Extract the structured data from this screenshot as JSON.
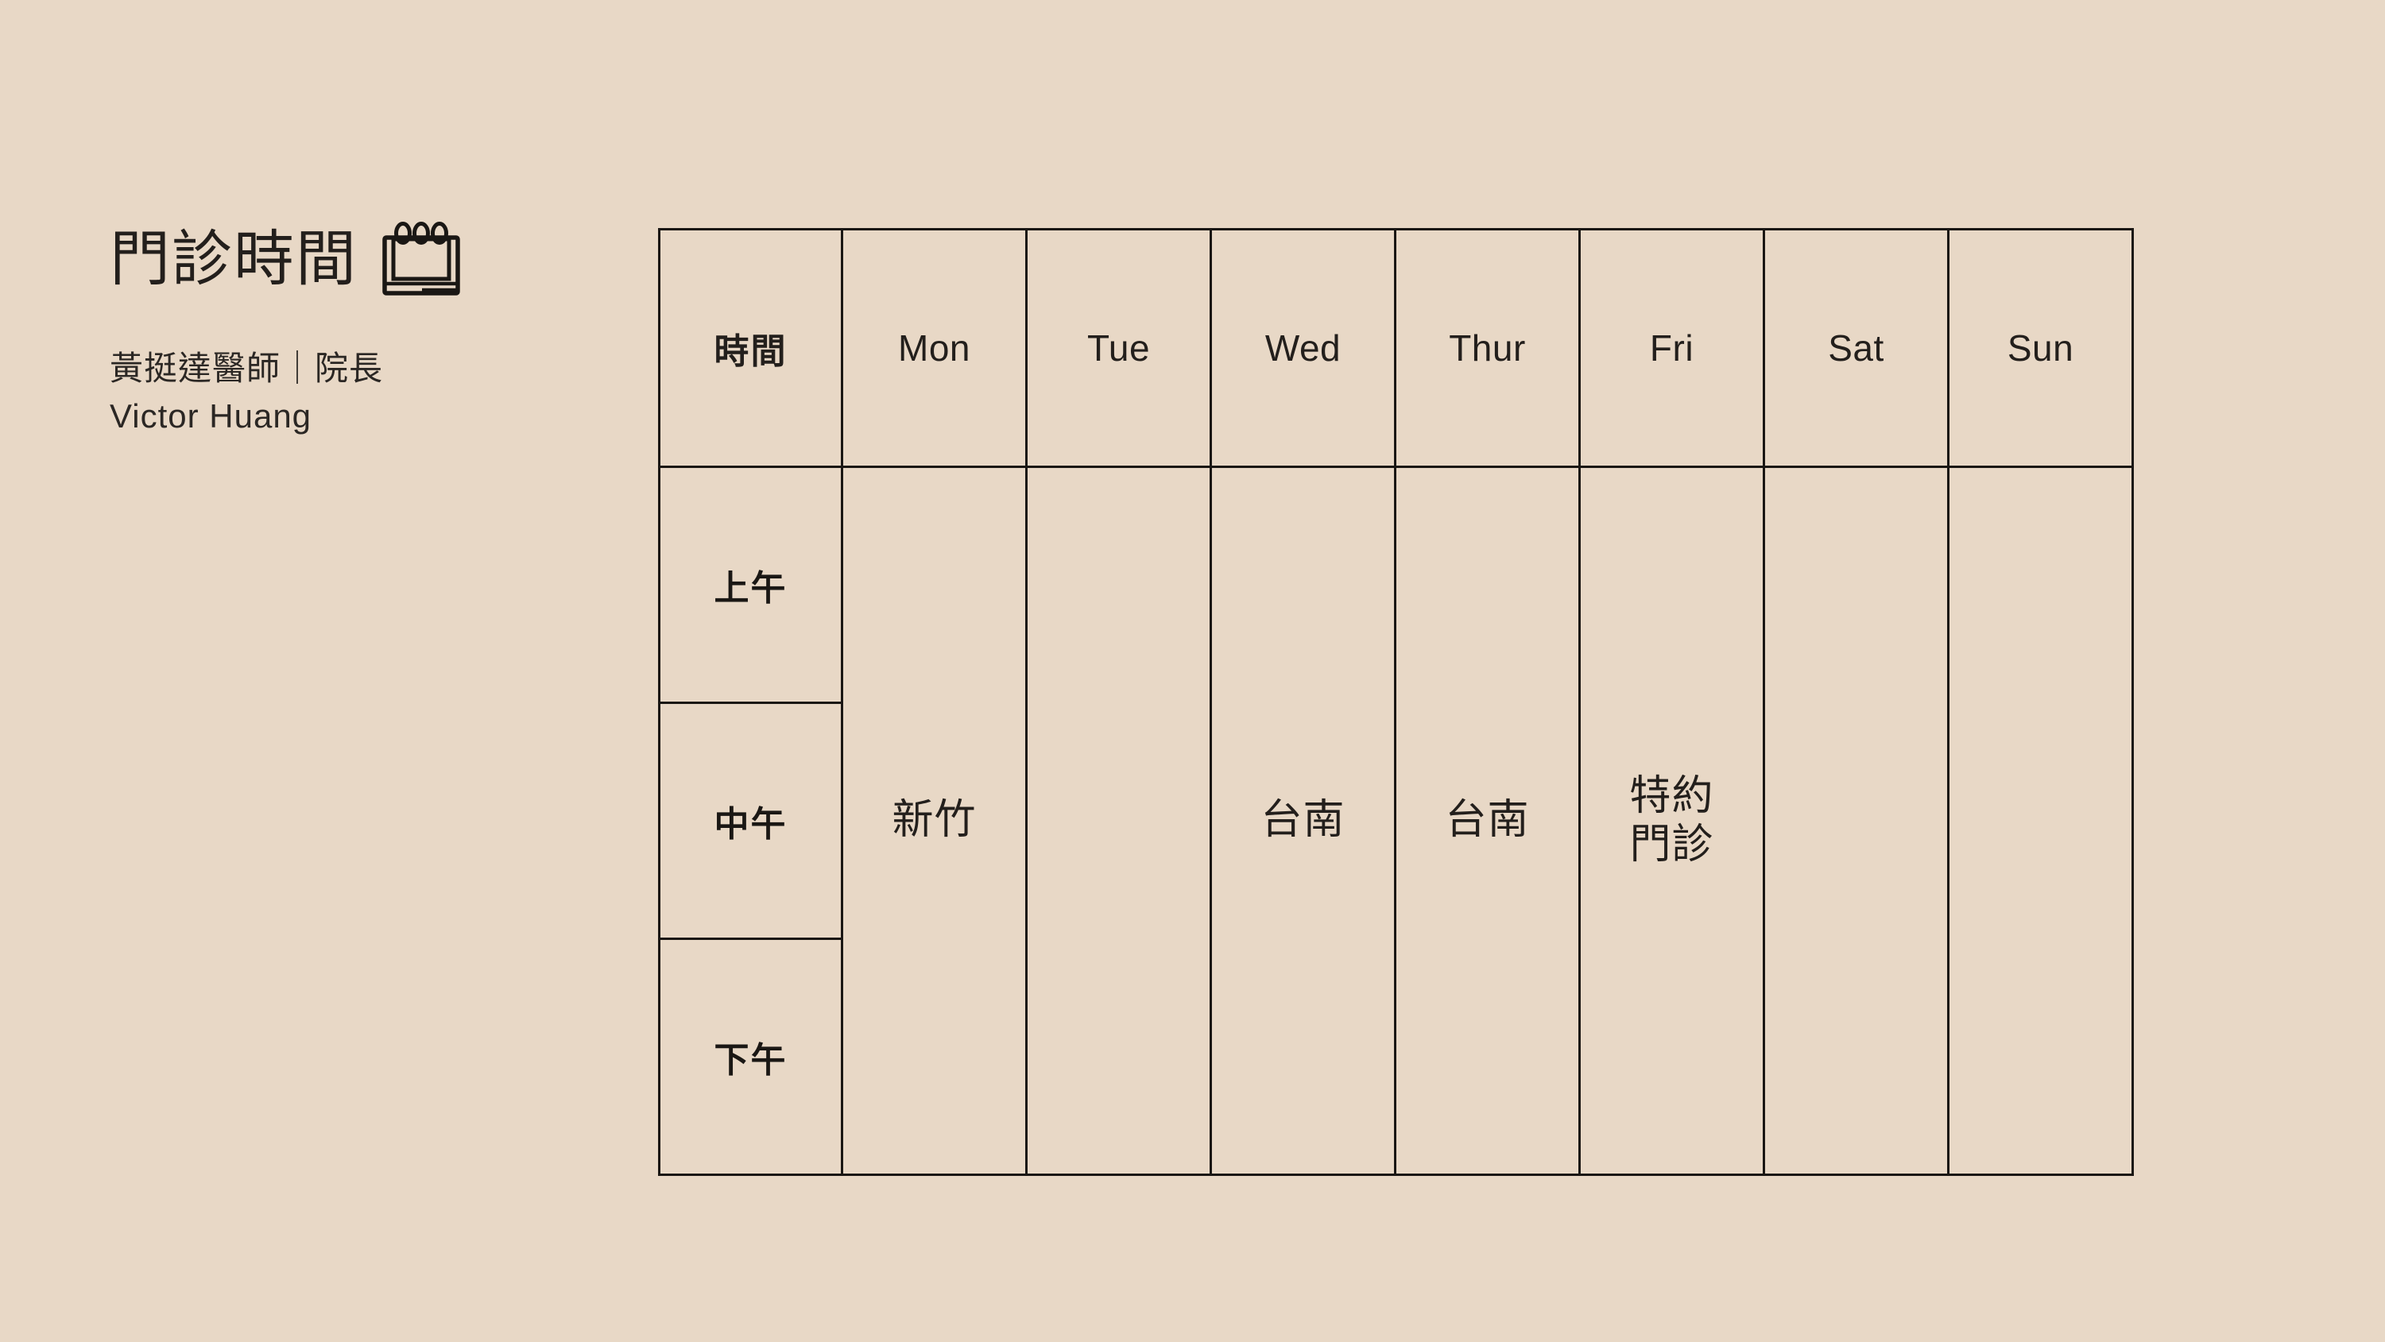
{
  "theme": {
    "background": "#e8d8c6",
    "ink": "#231f1c",
    "border": "#1a1714"
  },
  "header": {
    "title": "門診時間",
    "icon": "notepad-calendar-icon",
    "subtitle_line1": "黃挺達醫師｜院長",
    "subtitle_line2": "Victor Huang"
  },
  "schedule": {
    "columns": [
      {
        "key": "time",
        "label": "時間"
      },
      {
        "key": "mon",
        "label": "Mon"
      },
      {
        "key": "tue",
        "label": "Tue"
      },
      {
        "key": "wed",
        "label": "Wed"
      },
      {
        "key": "thur",
        "label": "Thur"
      },
      {
        "key": "fri",
        "label": "Fri"
      },
      {
        "key": "sat",
        "label": "Sat"
      },
      {
        "key": "sun",
        "label": "Sun"
      }
    ],
    "time_rows": [
      {
        "key": "morning",
        "label": "上午"
      },
      {
        "key": "noon",
        "label": "中午"
      },
      {
        "key": "afternoon",
        "label": "下午"
      }
    ],
    "day_values": [
      {
        "day": "Mon",
        "value": "新竹"
      },
      {
        "day": "Tue",
        "value": ""
      },
      {
        "day": "Wed",
        "value": "台南"
      },
      {
        "day": "Thur",
        "value": "台南"
      },
      {
        "day": "Fri",
        "value": "特約\n門診"
      },
      {
        "day": "Sat",
        "value": ""
      },
      {
        "day": "Sun",
        "value": ""
      }
    ]
  }
}
